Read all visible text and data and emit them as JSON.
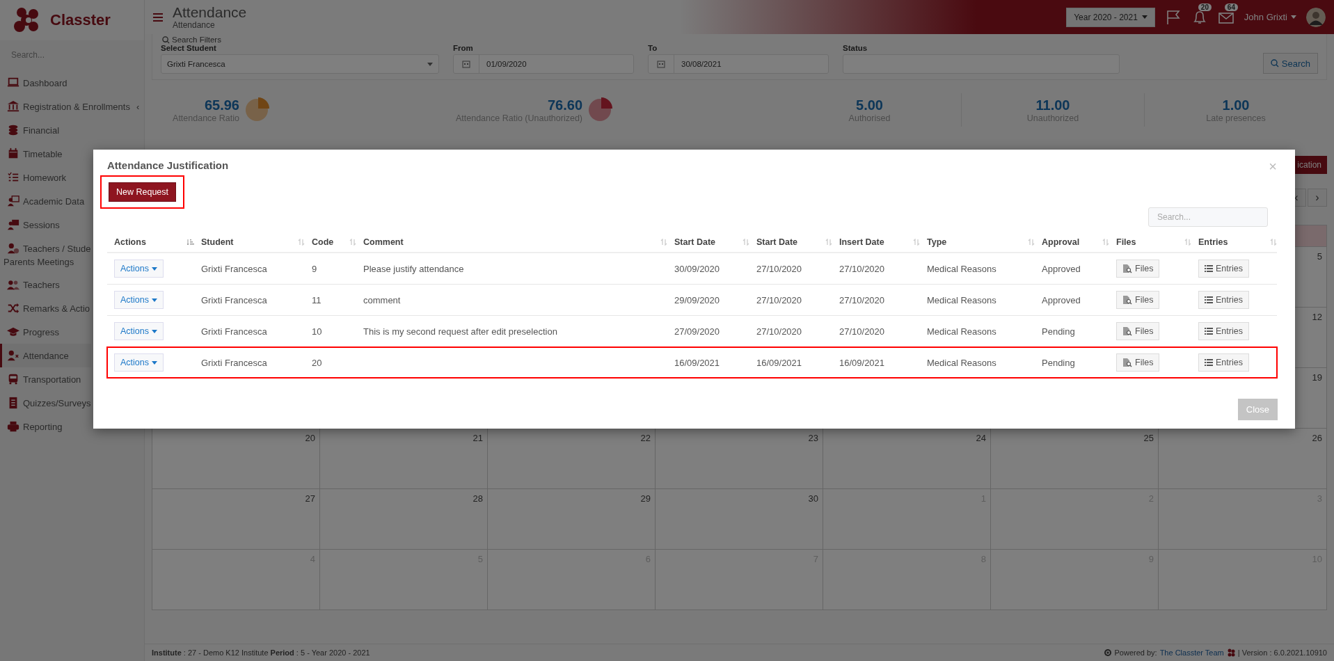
{
  "brand": {
    "name": "Classter"
  },
  "sidebar": {
    "search": {
      "placeholder": "Search..."
    },
    "items": [
      {
        "label": "Dashboard",
        "selected": false
      },
      {
        "label": "Registration & Enrollments",
        "selected": false,
        "submenu": "‹"
      },
      {
        "label": "Financial",
        "selected": false
      },
      {
        "label": "Timetable",
        "selected": false
      },
      {
        "label": "Homework",
        "selected": false
      },
      {
        "label": "Academic Data",
        "selected": false
      },
      {
        "label": "Sessions",
        "selected": false
      },
      {
        "label": "Teachers / Stude",
        "label_2": "Parents Meetings",
        "selected": false
      },
      {
        "label": "Teachers",
        "selected": false
      },
      {
        "label": "Remarks & Actio",
        "selected": false
      },
      {
        "label": "Progress",
        "selected": false
      },
      {
        "label": "Attendance",
        "selected": true
      },
      {
        "label": "Transportation",
        "selected": false
      },
      {
        "label": "Quizzes/Surveys",
        "selected": false
      },
      {
        "label": "Reporting",
        "selected": false
      }
    ]
  },
  "header": {
    "title": "Attendance",
    "subtitle": "Attendance",
    "year_select": "Year 2020 - 2021",
    "notifications": "20",
    "messages": "64",
    "user": "John Grixti"
  },
  "filters": {
    "title": "Search Filters",
    "student": {
      "label": "Select Student",
      "value": "Grixti Francesca"
    },
    "from": {
      "label": "From",
      "value": "01/09/2020"
    },
    "to": {
      "label": "To",
      "value": "30/08/2021"
    },
    "status": {
      "label": "Status"
    },
    "search_button": "Search"
  },
  "stats": [
    {
      "value": "65.96",
      "label": "Attendance Ratio",
      "kind": "pie"
    },
    {
      "value": "76.60",
      "label": "Attendance Ratio (Unauthorized)",
      "kind": "pie"
    },
    {
      "value": "5.00",
      "label": "Authorised",
      "kind": "plain"
    },
    {
      "value": "11.00",
      "label": "Unauthorized",
      "kind": "plain"
    },
    {
      "value": "1.00",
      "label": "Late presences",
      "kind": "plain"
    }
  ],
  "calendar": {
    "action_button": "ication",
    "prev": "‹",
    "next": "›",
    "weeks": [
      {
        "days": [
          {
            "day": "5",
            "other_month": false
          }
        ]
      },
      {
        "days": [
          {
            "day": "12",
            "other_month": false
          }
        ]
      },
      {
        "days": [
          {
            "day": "19",
            "other_month": false
          }
        ]
      },
      {
        "days": [
          {
            "day": "20",
            "other_month": false
          },
          {
            "day": "21",
            "other_month": false
          },
          {
            "day": "22",
            "other_month": false
          },
          {
            "day": "23",
            "other_month": false
          },
          {
            "day": "24",
            "other_month": false
          },
          {
            "day": "25",
            "other_month": false
          },
          {
            "day": "26",
            "other_month": false
          }
        ]
      },
      {
        "days": [
          {
            "day": "27",
            "other_month": false
          },
          {
            "day": "28",
            "other_month": false
          },
          {
            "day": "29",
            "other_month": false
          },
          {
            "day": "30",
            "other_month": false
          },
          {
            "day": "1",
            "other_month": true
          },
          {
            "day": "2",
            "other_month": true
          },
          {
            "day": "3",
            "other_month": true
          }
        ]
      },
      {
        "days": [
          {
            "day": "4",
            "other_month": true
          },
          {
            "day": "5",
            "other_month": true
          },
          {
            "day": "6",
            "other_month": true
          },
          {
            "day": "7",
            "other_month": true
          },
          {
            "day": "8",
            "other_month": true
          },
          {
            "day": "9",
            "other_month": true
          },
          {
            "day": "10",
            "other_month": true
          }
        ]
      }
    ]
  },
  "footer": {
    "left": "**Institute** : 27 - Demo K12 Institute **Period** : 5 - Year 2020 - 2021",
    "powered_by": "Powered by:",
    "team_link": "The Classter Team",
    "version": "| Version : 6.0.2021.10910"
  },
  "modal": {
    "title": "Attendance Justification",
    "close_x": "×",
    "new_request": {
      "label": "New Request",
      "highlighted": true
    },
    "search": {
      "placeholder": "Search..."
    },
    "columns": [
      {
        "label": "Actions",
        "sorted": true
      },
      {
        "label": "Student",
        "sorted": false
      },
      {
        "label": "Code",
        "sorted": false
      },
      {
        "label": "Comment",
        "sorted": false
      },
      {
        "label": "Start Date",
        "sorted": false
      },
      {
        "label": "Start Date",
        "sorted": false
      },
      {
        "label": "Insert Date",
        "sorted": false
      },
      {
        "label": "Type",
        "sorted": false
      },
      {
        "label": "Approval",
        "sorted": false
      },
      {
        "label": "Files",
        "sorted": false
      },
      {
        "label": "Entries",
        "sorted": false
      }
    ],
    "rows": [
      {
        "actions": "Actions",
        "student": "Grixti Francesca",
        "code": "9",
        "comment": "Please justify attendance",
        "start_date": "30/09/2020",
        "start_date_2": "27/10/2020",
        "insert_date": "27/10/2020",
        "type": "Medical Reasons",
        "approval": "Approved",
        "files": "Files",
        "entries": "Entries",
        "highlighted": false
      },
      {
        "actions": "Actions",
        "student": "Grixti Francesca",
        "code": "11",
        "comment": "comment",
        "start_date": "29/09/2020",
        "start_date_2": "27/10/2020",
        "insert_date": "27/10/2020",
        "type": "Medical Reasons",
        "approval": "Approved",
        "files": "Files",
        "entries": "Entries",
        "highlighted": false
      },
      {
        "actions": "Actions",
        "student": "Grixti Francesca",
        "code": "10",
        "comment": "This is my second request after edit preselection",
        "start_date": "27/09/2020",
        "start_date_2": "27/10/2020",
        "insert_date": "27/10/2020",
        "type": "Medical Reasons",
        "approval": "Pending",
        "files": "Files",
        "entries": "Entries",
        "highlighted": false
      },
      {
        "actions": "Actions",
        "student": "Grixti Francesca",
        "code": "20",
        "start_date": "16/09/2021",
        "start_date_2": "16/09/2021",
        "insert_date": "16/09/2021",
        "type": "Medical Reasons",
        "approval": "Pending",
        "files": "Files",
        "entries": "Entries",
        "highlighted": true
      }
    ],
    "close_button": "Close"
  }
}
